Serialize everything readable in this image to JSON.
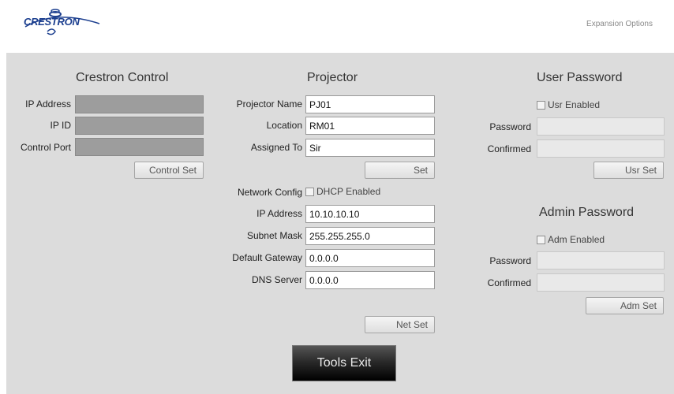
{
  "header": {
    "logo_text": "CRESTRON",
    "expansion_options": "Expansion Options"
  },
  "crestron_control": {
    "title": "Crestron Control",
    "ip_address_label": "IP Address",
    "ip_id_label": "IP ID",
    "control_port_label": "Control Port",
    "control_set_button": "Control Set"
  },
  "projector": {
    "title": "Projector",
    "projector_name_label": "Projector Name",
    "projector_name_value": "PJ01",
    "location_label": "Location",
    "location_value": "RM01",
    "assigned_to_label": "Assigned To",
    "assigned_to_value": "Sir",
    "set_button": "Set",
    "network_config_label": "Network Config",
    "dhcp_label": "DHCP Enabled",
    "ip_address_label": "IP Address",
    "ip_address_value": "10.10.10.10",
    "subnet_mask_label": "Subnet Mask",
    "subnet_mask_value": "255.255.255.0",
    "default_gateway_label": "Default Gateway",
    "default_gateway_value": "0.0.0.0",
    "dns_server_label": "DNS Server",
    "dns_server_value": "0.0.0.0",
    "net_set_button": "Net Set"
  },
  "user_password": {
    "title": "User Password",
    "enabled_label": "Usr Enabled",
    "password_label": "Password",
    "confirmed_label": "Confirmed",
    "set_button": "Usr Set"
  },
  "admin_password": {
    "title": "Admin Password",
    "enabled_label": "Adm Enabled",
    "password_label": "Password",
    "confirmed_label": "Confirmed",
    "set_button": "Adm Set"
  },
  "tools_exit_button": "Tools Exit",
  "colors": {
    "panel_bg": "#dcdcdc",
    "gray_field": "#9d9d9d",
    "brand": "#1c3f8f"
  }
}
